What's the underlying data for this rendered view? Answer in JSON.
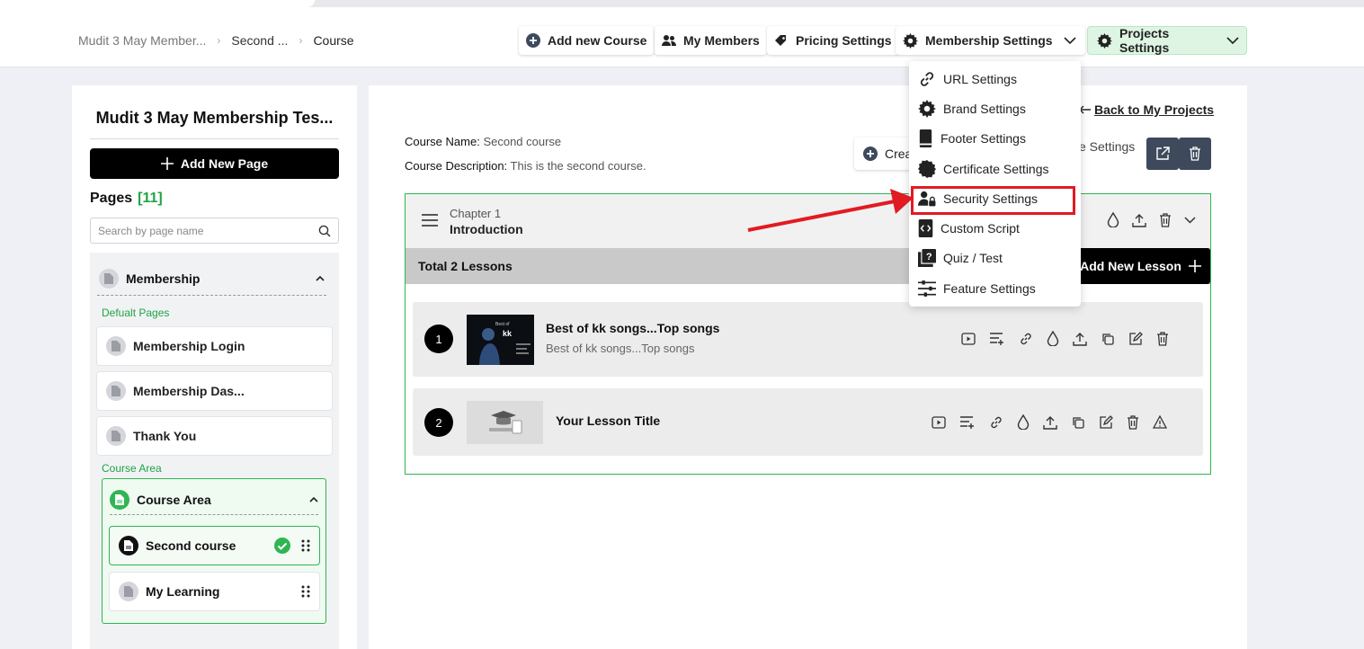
{
  "breadcrumb": {
    "item1": "Mudit 3 May Member...",
    "item2": "Second ...",
    "item3": "Course"
  },
  "topbar": {
    "add_course": "Add new Course",
    "my_members": "My Members",
    "pricing": "Pricing Settings",
    "membership": "Membership Settings",
    "projects": "Projects Settings"
  },
  "sidebar": {
    "title": "Mudit 3 May Membership Tes...",
    "add_page": "Add New Page",
    "pages_label": "Pages",
    "pages_count": "[11]",
    "search_placeholder": "Search by page name",
    "group": "Membership",
    "default_label": "Defualt Pages",
    "default_pages": [
      "Membership Login",
      "Membership Das...",
      "Thank You"
    ],
    "course_area_label": "Course Area",
    "course_area_title": "Course Area",
    "course_items": [
      "Second course",
      "My Learning"
    ]
  },
  "main": {
    "back": "Back to My Projects",
    "course_name_label": "Course Name:",
    "course_name": "Second course",
    "course_desc_label": "Course Description:",
    "course_desc": "This is the second course.",
    "create_btn": "Crea",
    "settings_btn": "e Settings",
    "chapter_num": "Chapter 1",
    "chapter_title": "Introduction",
    "total_lessons": "Total 2 Lessons",
    "add_lesson": "Add New Lesson",
    "lessons": [
      {
        "num": "1",
        "title": "Best of kk songs...Top songs",
        "desc": "Best of kk songs...Top songs"
      },
      {
        "num": "2",
        "title": "Your Lesson Title",
        "desc": ""
      }
    ]
  },
  "thumbnail_text": {
    "small": "Best of",
    "big": "kk"
  },
  "dropdown": {
    "items": [
      "URL Settings",
      "Brand Settings",
      "Footer Settings",
      "Certificate Settings",
      "Security Settings",
      "Custom Script",
      "Quiz / Test",
      "Feature Settings"
    ]
  },
  "colors": {
    "accent_green": "#1ea446",
    "highlight_red": "#e11b22",
    "dark_button": "#3e4a5c"
  }
}
